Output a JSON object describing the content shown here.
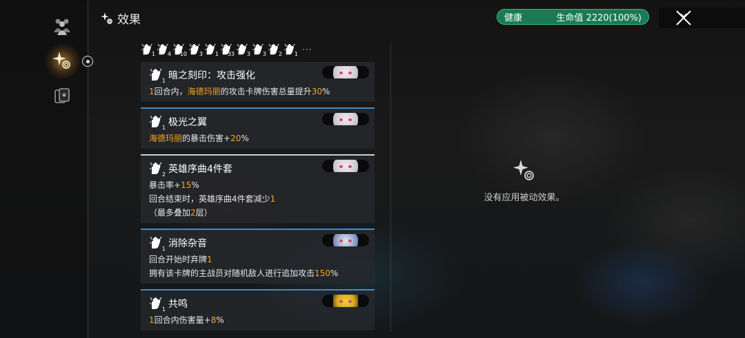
{
  "header": {
    "title": "效果",
    "icon": "sparkle-swirl-icon"
  },
  "health": {
    "status": "健康",
    "hp_label": "生命值 2220(100%)",
    "color": "#1a7a55"
  },
  "rail": {
    "items": [
      {
        "name": "team-icon",
        "active": false
      },
      {
        "name": "effects-icon",
        "active": true
      },
      {
        "name": "cards-icon",
        "active": false
      }
    ]
  },
  "icon_row": {
    "items": [
      {
        "count": "1"
      },
      {
        "count": "4"
      },
      {
        "count": "10"
      },
      {
        "count": "3"
      },
      {
        "count": "1"
      },
      {
        "count": "33"
      },
      {
        "count": "3"
      },
      {
        "count": "3"
      },
      {
        "count": "2"
      },
      {
        "count": "1"
      }
    ],
    "more": "···"
  },
  "effects": [
    {
      "title": "暗之刻印：攻击强化",
      "count": "1",
      "lines": [
        [
          {
            "t": "1",
            "hl": true
          },
          {
            "t": "回合内，",
            "hl": false
          },
          {
            "t": "海德玛丽",
            "hl": true
          },
          {
            "t": "的攻击卡牌伤害总量提升",
            "hl": false
          },
          {
            "t": "30",
            "hl": true
          },
          {
            "t": "%",
            "hl": false
          }
        ]
      ]
    },
    {
      "title": "极光之翼",
      "count": "1",
      "lines": [
        [
          {
            "t": "海德玛丽",
            "hl": true
          },
          {
            "t": "的暴击伤害+",
            "hl": false
          },
          {
            "t": "20",
            "hl": true
          },
          {
            "t": "%",
            "hl": false
          }
        ]
      ]
    },
    {
      "title": "英雄序曲4件套",
      "count": "2",
      "lines": [
        [
          {
            "t": "暴击率+",
            "hl": false
          },
          {
            "t": "15",
            "hl": true
          },
          {
            "t": "%",
            "hl": false
          }
        ],
        [
          {
            "t": "回合结束时，英雄序曲4件套减少",
            "hl": false
          },
          {
            "t": "1",
            "hl": true
          }
        ],
        [
          {
            "t": "（最多叠加",
            "hl": false
          },
          {
            "t": "2",
            "hl": true
          },
          {
            "t": "层）",
            "hl": false
          }
        ]
      ]
    },
    {
      "title": "消除杂音",
      "count": "1",
      "lines": [
        [
          {
            "t": "回合开始时弃牌",
            "hl": false
          },
          {
            "t": "1",
            "hl": true
          }
        ],
        [
          {
            "t": "拥有该卡牌的主战员对随机敌人进行追加攻击",
            "hl": false
          },
          {
            "t": "150",
            "hl": true
          },
          {
            "t": "%",
            "hl": false
          }
        ]
      ]
    },
    {
      "title": "共鸣",
      "count": "1",
      "lines": [
        [
          {
            "t": "1",
            "hl": true
          },
          {
            "t": "回合内伤害量+",
            "hl": false
          },
          {
            "t": "8",
            "hl": true
          },
          {
            "t": "%",
            "hl": false
          }
        ]
      ]
    }
  ],
  "passive": {
    "message": "没有应用被动效果。"
  },
  "colors": {
    "highlight": "#f5a623",
    "accent_blue": "#3a8fd0",
    "health_green": "#1a7a55"
  }
}
